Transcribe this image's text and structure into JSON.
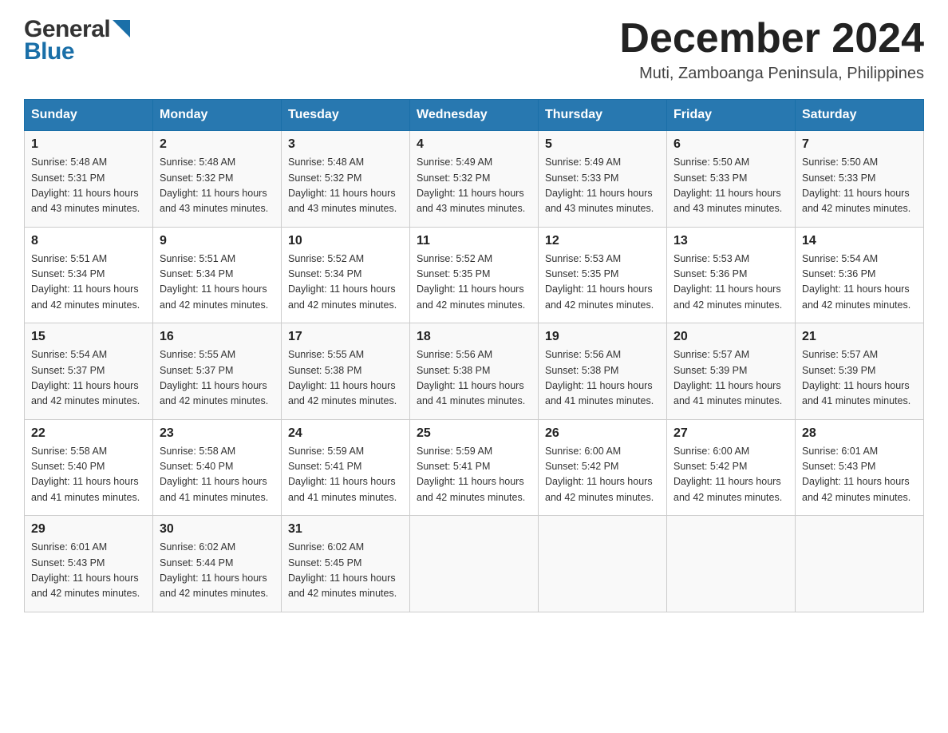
{
  "logo": {
    "general": "General",
    "blue": "Blue"
  },
  "title": {
    "month_year": "December 2024",
    "location": "Muti, Zamboanga Peninsula, Philippines"
  },
  "days_of_week": [
    "Sunday",
    "Monday",
    "Tuesday",
    "Wednesday",
    "Thursday",
    "Friday",
    "Saturday"
  ],
  "weeks": [
    [
      {
        "day": "1",
        "sunrise": "5:48 AM",
        "sunset": "5:31 PM",
        "daylight": "11 hours and 43 minutes."
      },
      {
        "day": "2",
        "sunrise": "5:48 AM",
        "sunset": "5:32 PM",
        "daylight": "11 hours and 43 minutes."
      },
      {
        "day": "3",
        "sunrise": "5:48 AM",
        "sunset": "5:32 PM",
        "daylight": "11 hours and 43 minutes."
      },
      {
        "day": "4",
        "sunrise": "5:49 AM",
        "sunset": "5:32 PM",
        "daylight": "11 hours and 43 minutes."
      },
      {
        "day": "5",
        "sunrise": "5:49 AM",
        "sunset": "5:33 PM",
        "daylight": "11 hours and 43 minutes."
      },
      {
        "day": "6",
        "sunrise": "5:50 AM",
        "sunset": "5:33 PM",
        "daylight": "11 hours and 43 minutes."
      },
      {
        "day": "7",
        "sunrise": "5:50 AM",
        "sunset": "5:33 PM",
        "daylight": "11 hours and 42 minutes."
      }
    ],
    [
      {
        "day": "8",
        "sunrise": "5:51 AM",
        "sunset": "5:34 PM",
        "daylight": "11 hours and 42 minutes."
      },
      {
        "day": "9",
        "sunrise": "5:51 AM",
        "sunset": "5:34 PM",
        "daylight": "11 hours and 42 minutes."
      },
      {
        "day": "10",
        "sunrise": "5:52 AM",
        "sunset": "5:34 PM",
        "daylight": "11 hours and 42 minutes."
      },
      {
        "day": "11",
        "sunrise": "5:52 AM",
        "sunset": "5:35 PM",
        "daylight": "11 hours and 42 minutes."
      },
      {
        "day": "12",
        "sunrise": "5:53 AM",
        "sunset": "5:35 PM",
        "daylight": "11 hours and 42 minutes."
      },
      {
        "day": "13",
        "sunrise": "5:53 AM",
        "sunset": "5:36 PM",
        "daylight": "11 hours and 42 minutes."
      },
      {
        "day": "14",
        "sunrise": "5:54 AM",
        "sunset": "5:36 PM",
        "daylight": "11 hours and 42 minutes."
      }
    ],
    [
      {
        "day": "15",
        "sunrise": "5:54 AM",
        "sunset": "5:37 PM",
        "daylight": "11 hours and 42 minutes."
      },
      {
        "day": "16",
        "sunrise": "5:55 AM",
        "sunset": "5:37 PM",
        "daylight": "11 hours and 42 minutes."
      },
      {
        "day": "17",
        "sunrise": "5:55 AM",
        "sunset": "5:38 PM",
        "daylight": "11 hours and 42 minutes."
      },
      {
        "day": "18",
        "sunrise": "5:56 AM",
        "sunset": "5:38 PM",
        "daylight": "11 hours and 41 minutes."
      },
      {
        "day": "19",
        "sunrise": "5:56 AM",
        "sunset": "5:38 PM",
        "daylight": "11 hours and 41 minutes."
      },
      {
        "day": "20",
        "sunrise": "5:57 AM",
        "sunset": "5:39 PM",
        "daylight": "11 hours and 41 minutes."
      },
      {
        "day": "21",
        "sunrise": "5:57 AM",
        "sunset": "5:39 PM",
        "daylight": "11 hours and 41 minutes."
      }
    ],
    [
      {
        "day": "22",
        "sunrise": "5:58 AM",
        "sunset": "5:40 PM",
        "daylight": "11 hours and 41 minutes."
      },
      {
        "day": "23",
        "sunrise": "5:58 AM",
        "sunset": "5:40 PM",
        "daylight": "11 hours and 41 minutes."
      },
      {
        "day": "24",
        "sunrise": "5:59 AM",
        "sunset": "5:41 PM",
        "daylight": "11 hours and 41 minutes."
      },
      {
        "day": "25",
        "sunrise": "5:59 AM",
        "sunset": "5:41 PM",
        "daylight": "11 hours and 42 minutes."
      },
      {
        "day": "26",
        "sunrise": "6:00 AM",
        "sunset": "5:42 PM",
        "daylight": "11 hours and 42 minutes."
      },
      {
        "day": "27",
        "sunrise": "6:00 AM",
        "sunset": "5:42 PM",
        "daylight": "11 hours and 42 minutes."
      },
      {
        "day": "28",
        "sunrise": "6:01 AM",
        "sunset": "5:43 PM",
        "daylight": "11 hours and 42 minutes."
      }
    ],
    [
      {
        "day": "29",
        "sunrise": "6:01 AM",
        "sunset": "5:43 PM",
        "daylight": "11 hours and 42 minutes."
      },
      {
        "day": "30",
        "sunrise": "6:02 AM",
        "sunset": "5:44 PM",
        "daylight": "11 hours and 42 minutes."
      },
      {
        "day": "31",
        "sunrise": "6:02 AM",
        "sunset": "5:45 PM",
        "daylight": "11 hours and 42 minutes."
      },
      null,
      null,
      null,
      null
    ]
  ],
  "labels": {
    "sunrise": "Sunrise:",
    "sunset": "Sunset:",
    "daylight": "Daylight:"
  }
}
